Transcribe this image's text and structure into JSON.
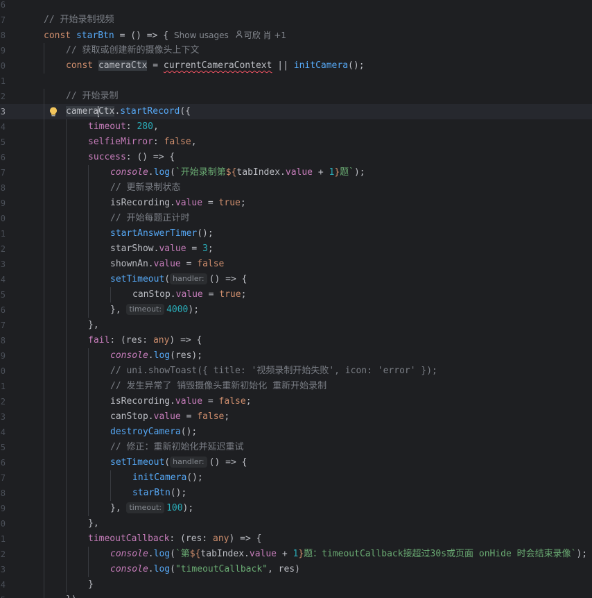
{
  "editor": {
    "lines": [
      {
        "ln": "6",
        "indent": 0,
        "tokens": []
      },
      {
        "ln": "7",
        "indent": 0,
        "tokens": [
          {
            "t": "// 开始录制视频",
            "c": "cmt"
          }
        ]
      },
      {
        "ln": "8",
        "indent": 0,
        "tokens": [
          {
            "t": "const ",
            "c": "kw"
          },
          {
            "t": "starBtn",
            "c": "fnd"
          },
          {
            "t": " = () => {",
            "c": "var"
          }
        ],
        "lens": {
          "usages": "Show usages",
          "author": "可欣 肖 +1"
        }
      },
      {
        "ln": "9",
        "indent": 1,
        "tokens": [
          {
            "t": "// 获取或创建新的摄像头上下文",
            "c": "cmt"
          }
        ]
      },
      {
        "ln": "0",
        "indent": 1,
        "tokens": [
          {
            "t": "const ",
            "c": "kw"
          },
          {
            "t": "cameraCtx",
            "c": "var hl"
          },
          {
            "t": " = ",
            "c": "var"
          },
          {
            "t": "currentCameraContext",
            "c": "var squig"
          },
          {
            "t": " || ",
            "c": "var"
          },
          {
            "t": "initCamera",
            "c": "fn"
          },
          {
            "t": "();",
            "c": "var"
          }
        ]
      },
      {
        "ln": "1",
        "indent": 0,
        "tokens": []
      },
      {
        "ln": "2",
        "indent": 1,
        "tokens": [
          {
            "t": "// 开始录制",
            "c": "cmt"
          }
        ]
      },
      {
        "ln": "3",
        "indent": 1,
        "current": true,
        "bulb": true,
        "tokens": [
          {
            "t": "camera",
            "c": "var hl"
          },
          {
            "caret": true
          },
          {
            "t": "Ctx",
            "c": "var hl"
          },
          {
            "t": ".",
            "c": "var"
          },
          {
            "t": "startRecord",
            "c": "fn"
          },
          {
            "t": "({",
            "c": "var"
          }
        ]
      },
      {
        "ln": "4",
        "indent": 2,
        "tokens": [
          {
            "t": "timeout",
            "c": "prop"
          },
          {
            "t": ": ",
            "c": "var"
          },
          {
            "t": "280",
            "c": "num"
          },
          {
            "t": ",",
            "c": "var"
          }
        ]
      },
      {
        "ln": "5",
        "indent": 2,
        "tokens": [
          {
            "t": "selfieMirror",
            "c": "prop"
          },
          {
            "t": ": ",
            "c": "var"
          },
          {
            "t": "false",
            "c": "kw"
          },
          {
            "t": ",",
            "c": "var"
          }
        ]
      },
      {
        "ln": "6",
        "indent": 2,
        "tokens": [
          {
            "t": "success",
            "c": "prop"
          },
          {
            "t": ": () => {",
            "c": "var"
          }
        ]
      },
      {
        "ln": "7",
        "indent": 3,
        "tokens": [
          {
            "t": "console",
            "c": "con"
          },
          {
            "t": ".",
            "c": "var"
          },
          {
            "t": "log",
            "c": "fn"
          },
          {
            "t": "(",
            "c": "var"
          },
          {
            "t": "`开始录制第",
            "c": "str"
          },
          {
            "t": "${",
            "c": "kw"
          },
          {
            "t": "tabIndex",
            "c": "var"
          },
          {
            "t": ".",
            "c": "var"
          },
          {
            "t": "value",
            "c": "prop"
          },
          {
            "t": " + ",
            "c": "var"
          },
          {
            "t": "1",
            "c": "num"
          },
          {
            "t": "}",
            "c": "kw"
          },
          {
            "t": "题`",
            "c": "str"
          },
          {
            "t": ");",
            "c": "var"
          }
        ]
      },
      {
        "ln": "8",
        "indent": 3,
        "tokens": [
          {
            "t": "// 更新录制状态",
            "c": "cmt"
          }
        ]
      },
      {
        "ln": "9",
        "indent": 3,
        "tokens": [
          {
            "t": "isRecording",
            "c": "var"
          },
          {
            "t": ".",
            "c": "var"
          },
          {
            "t": "value",
            "c": "prop"
          },
          {
            "t": " = ",
            "c": "var"
          },
          {
            "t": "true",
            "c": "kw"
          },
          {
            "t": ";",
            "c": "var"
          }
        ]
      },
      {
        "ln": "0",
        "indent": 3,
        "tokens": [
          {
            "t": "// 开始每题正计时",
            "c": "cmt"
          }
        ]
      },
      {
        "ln": "1",
        "indent": 3,
        "tokens": [
          {
            "t": "startAnswerTimer",
            "c": "fn"
          },
          {
            "t": "();",
            "c": "var"
          }
        ]
      },
      {
        "ln": "2",
        "indent": 3,
        "tokens": [
          {
            "t": "starShow",
            "c": "var"
          },
          {
            "t": ".",
            "c": "var"
          },
          {
            "t": "value",
            "c": "prop"
          },
          {
            "t": " = ",
            "c": "var"
          },
          {
            "t": "3",
            "c": "num"
          },
          {
            "t": ";",
            "c": "var"
          }
        ]
      },
      {
        "ln": "3",
        "indent": 3,
        "tokens": [
          {
            "t": "shownAn",
            "c": "var"
          },
          {
            "t": ".",
            "c": "var"
          },
          {
            "t": "value",
            "c": "prop"
          },
          {
            "t": " = ",
            "c": "var"
          },
          {
            "t": "false",
            "c": "kw"
          }
        ]
      },
      {
        "ln": "4",
        "indent": 3,
        "tokens": [
          {
            "t": "setTimeout",
            "c": "fn"
          },
          {
            "t": "(",
            "c": "var"
          },
          {
            "hint": "handler:"
          },
          {
            "t": "() => {",
            "c": "var"
          }
        ]
      },
      {
        "ln": "5",
        "indent": 4,
        "tokens": [
          {
            "t": "canStop",
            "c": "var"
          },
          {
            "t": ".",
            "c": "var"
          },
          {
            "t": "value",
            "c": "prop"
          },
          {
            "t": " = ",
            "c": "var"
          },
          {
            "t": "true",
            "c": "kw"
          },
          {
            "t": ";",
            "c": "var"
          }
        ]
      },
      {
        "ln": "6",
        "indent": 3,
        "tokens": [
          {
            "t": "}, ",
            "c": "var"
          },
          {
            "hint": "timeout:"
          },
          {
            "t": "4000",
            "c": "num"
          },
          {
            "t": ");",
            "c": "var"
          }
        ]
      },
      {
        "ln": "7",
        "indent": 2,
        "tokens": [
          {
            "t": "},",
            "c": "var"
          }
        ]
      },
      {
        "ln": "8",
        "indent": 2,
        "tokens": [
          {
            "t": "fail",
            "c": "prop"
          },
          {
            "t": ": (",
            "c": "var"
          },
          {
            "t": "res",
            "c": "var"
          },
          {
            "t": ": ",
            "c": "var"
          },
          {
            "t": "any",
            "c": "typ"
          },
          {
            "t": ") => {",
            "c": "var"
          }
        ]
      },
      {
        "ln": "9",
        "indent": 3,
        "tokens": [
          {
            "t": "console",
            "c": "con"
          },
          {
            "t": ".",
            "c": "var"
          },
          {
            "t": "log",
            "c": "fn"
          },
          {
            "t": "(res);",
            "c": "var"
          }
        ]
      },
      {
        "ln": "0",
        "indent": 3,
        "tokens": [
          {
            "t": "// uni.showToast({ title: '视频录制开始失败', icon: 'error' });",
            "c": "cmt"
          }
        ]
      },
      {
        "ln": "1",
        "indent": 3,
        "tokens": [
          {
            "t": "// 发生异常了 销毁摄像头重新初始化 重新开始录制",
            "c": "cmt"
          }
        ]
      },
      {
        "ln": "2",
        "indent": 3,
        "tokens": [
          {
            "t": "isRecording",
            "c": "var"
          },
          {
            "t": ".",
            "c": "var"
          },
          {
            "t": "value",
            "c": "prop"
          },
          {
            "t": " = ",
            "c": "var"
          },
          {
            "t": "false",
            "c": "kw"
          },
          {
            "t": ";",
            "c": "var"
          }
        ]
      },
      {
        "ln": "3",
        "indent": 3,
        "tokens": [
          {
            "t": "canStop",
            "c": "var"
          },
          {
            "t": ".",
            "c": "var"
          },
          {
            "t": "value",
            "c": "prop"
          },
          {
            "t": " = ",
            "c": "var"
          },
          {
            "t": "false",
            "c": "kw"
          },
          {
            "t": ";",
            "c": "var"
          }
        ]
      },
      {
        "ln": "4",
        "indent": 3,
        "tokens": [
          {
            "t": "destroyCamera",
            "c": "fn"
          },
          {
            "t": "();",
            "c": "var"
          }
        ]
      },
      {
        "ln": "5",
        "indent": 3,
        "tokens": [
          {
            "t": "// 修正：重新初始化并延迟重试",
            "c": "cmt"
          }
        ]
      },
      {
        "ln": "6",
        "indent": 3,
        "tokens": [
          {
            "t": "setTimeout",
            "c": "fn"
          },
          {
            "t": "(",
            "c": "var"
          },
          {
            "hint": "handler:"
          },
          {
            "t": "() => {",
            "c": "var"
          }
        ]
      },
      {
        "ln": "7",
        "indent": 4,
        "tokens": [
          {
            "t": "initCamera",
            "c": "fn"
          },
          {
            "t": "();",
            "c": "var"
          }
        ]
      },
      {
        "ln": "8",
        "indent": 4,
        "tokens": [
          {
            "t": "starBtn",
            "c": "fn"
          },
          {
            "t": "();",
            "c": "var"
          }
        ]
      },
      {
        "ln": "9",
        "indent": 3,
        "tokens": [
          {
            "t": "}, ",
            "c": "var"
          },
          {
            "hint": "timeout:"
          },
          {
            "t": "100",
            "c": "num"
          },
          {
            "t": ");",
            "c": "var"
          }
        ]
      },
      {
        "ln": "0",
        "indent": 2,
        "tokens": [
          {
            "t": "},",
            "c": "var"
          }
        ]
      },
      {
        "ln": "1",
        "indent": 2,
        "tokens": [
          {
            "t": "timeoutCallback",
            "c": "prop"
          },
          {
            "t": ": (",
            "c": "var"
          },
          {
            "t": "res",
            "c": "var"
          },
          {
            "t": ": ",
            "c": "var"
          },
          {
            "t": "any",
            "c": "typ"
          },
          {
            "t": ") => {",
            "c": "var"
          }
        ]
      },
      {
        "ln": "2",
        "indent": 3,
        "tokens": [
          {
            "t": "console",
            "c": "con"
          },
          {
            "t": ".",
            "c": "var"
          },
          {
            "t": "log",
            "c": "fn"
          },
          {
            "t": "(",
            "c": "var"
          },
          {
            "t": "`第",
            "c": "str"
          },
          {
            "t": "${",
            "c": "kw"
          },
          {
            "t": "tabIndex",
            "c": "var"
          },
          {
            "t": ".",
            "c": "var"
          },
          {
            "t": "value",
            "c": "prop"
          },
          {
            "t": " + ",
            "c": "var"
          },
          {
            "t": "1",
            "c": "num"
          },
          {
            "t": "}",
            "c": "kw"
          },
          {
            "t": "题：timeoutCallback接超过30s或页面 onHide 时会结束录像`",
            "c": "str"
          },
          {
            "t": ");",
            "c": "var"
          }
        ]
      },
      {
        "ln": "3",
        "indent": 3,
        "tokens": [
          {
            "t": "console",
            "c": "con"
          },
          {
            "t": ".",
            "c": "var"
          },
          {
            "t": "log",
            "c": "fn"
          },
          {
            "t": "(",
            "c": "var"
          },
          {
            "t": "\"timeoutCallback\"",
            "c": "str"
          },
          {
            "t": ", res)",
            "c": "var"
          }
        ]
      },
      {
        "ln": "4",
        "indent": 2,
        "tokens": [
          {
            "t": "}",
            "c": "var"
          }
        ]
      },
      {
        "ln": "5",
        "indent": 1,
        "tokens": [
          {
            "t": "})",
            "c": "var"
          }
        ]
      }
    ]
  },
  "colors": {
    "background": "#1e1f22",
    "current_line": "#26282e",
    "keyword": "#cf8e6d",
    "function": "#56a8f5",
    "property": "#c77dbb",
    "number": "#2aacb8",
    "string": "#6aab73",
    "comment": "#7a7e85",
    "bulb": "#f2c55c"
  },
  "icons": {
    "bulb": "lightbulb-icon",
    "author": "user-icon"
  }
}
